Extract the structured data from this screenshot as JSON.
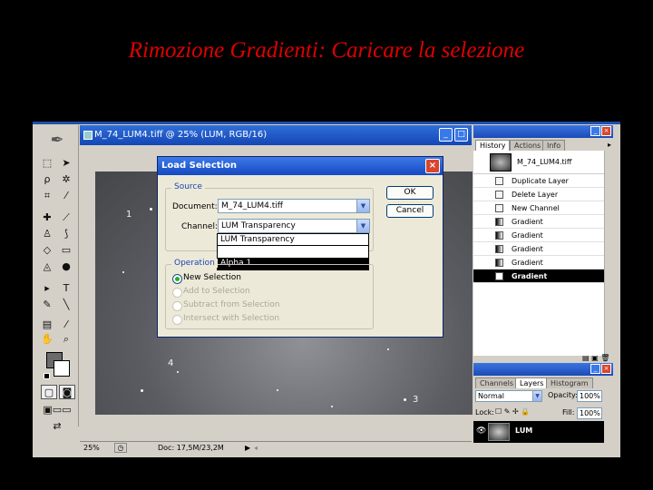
{
  "slide_title": "Rimozione Gradienti: Caricare la selezione",
  "document_window": {
    "title": "M_74_LUM4.tiff @ 25% (LUM, RGB/16)",
    "zoom": "25%",
    "doc_size": "Doc: 17,5M/23,2M"
  },
  "canvas_markers": [
    "1",
    "4",
    "3"
  ],
  "load_selection_dialog": {
    "title": "Load Selection",
    "source_label": "Source",
    "document_label": "Document:",
    "document_value": "M_74_LUM4.tiff",
    "channel_label": "Channel:",
    "channel_value": "LUM Transparency",
    "channel_options": [
      "LUM Transparency",
      "",
      "Alpha 1"
    ],
    "operation_label": "Operation",
    "operations": [
      "New Selection",
      "Add to Selection",
      "Subtract from Selection",
      "Intersect with Selection"
    ],
    "ok_label": "OK",
    "cancel_label": "Cancel"
  },
  "history_panel": {
    "tabs": [
      "History",
      "Actions",
      "Info"
    ],
    "snapshot_name": "M_74_LUM4.tiff",
    "items": [
      "Duplicate Layer",
      "Delete Layer",
      "New Channel",
      "Gradient",
      "Gradient",
      "Gradient",
      "Gradient",
      "Gradient"
    ]
  },
  "layers_panel": {
    "tabs": [
      "Channels",
      "Layers",
      "Histogram"
    ],
    "blend_mode": "Normal",
    "opacity_label": "Opacity:",
    "opacity_value": "100%",
    "lock_label": "Lock:",
    "fill_label": "Fill:",
    "fill_value": "100%",
    "layer_name": "LUM"
  },
  "colors": {
    "title_red": "#e00000",
    "xp_blue": "#1446b6",
    "dialog_bg": "#ece9d8"
  }
}
